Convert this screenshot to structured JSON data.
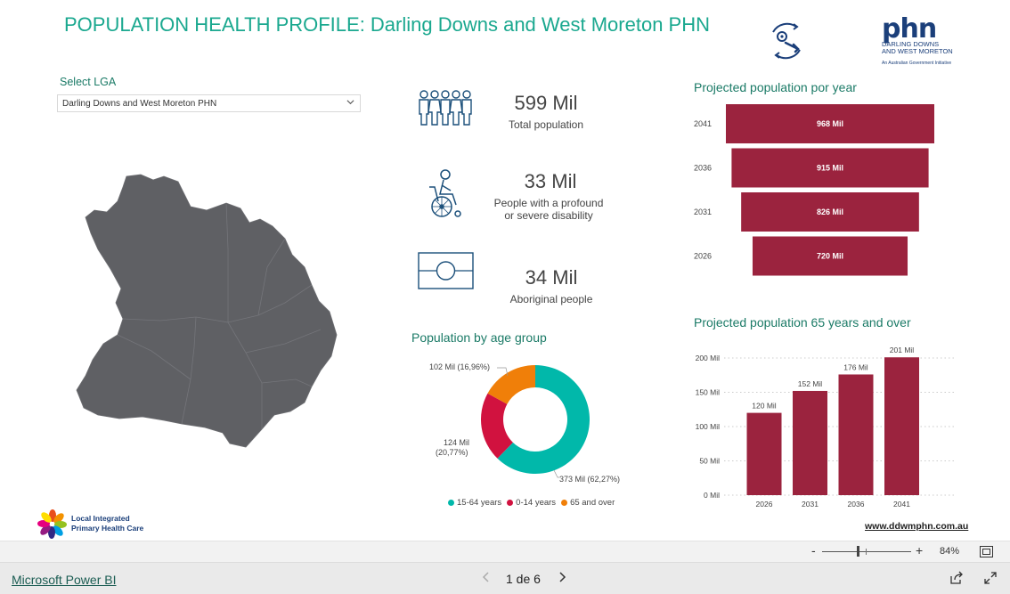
{
  "title": "POPULATION HEALTH PROFILE: Darling Downs and West Moreton PHN",
  "logos": {
    "phn_big": "phn",
    "phn_line1": "DARLING DOWNS",
    "phn_line2": "AND WEST MORETON",
    "phn_tagline": "An Australian Government Initiative",
    "lipc_line1": "Local Integrated",
    "lipc_line2": "Primary Health Care"
  },
  "filter": {
    "label": "Select LGA",
    "value": "Darling Downs and West Moreton PHN"
  },
  "kpis": {
    "total": {
      "value": "599 Mil",
      "label": "Total population",
      "icon": "people-group-icon"
    },
    "disability": {
      "value": "33 Mil",
      "label_line1": "People with a profound",
      "label_line2": "or severe disability",
      "icon": "wheelchair-icon"
    },
    "aboriginal": {
      "value": "34 Mil",
      "label": "Aboriginal people",
      "icon": "aboriginal-flag-icon"
    }
  },
  "sections": {
    "age_group": "Population by age group",
    "projected": "Projected population por year",
    "projected65": "Projected population 65 years and over"
  },
  "chart_data": [
    {
      "type": "pie",
      "title": "Population by age group",
      "donut": true,
      "categories": [
        "15-64 years",
        "0-14 years",
        "65 and over"
      ],
      "values": [
        373,
        124,
        102
      ],
      "percent": [
        62.27,
        20.77,
        16.96
      ],
      "labels": [
        "373 Mil (62,27%)",
        "124 Mil (20,77%)",
        "102 Mil (16,96%)"
      ],
      "colors": [
        "#01b8aa",
        "#d1123f",
        "#f07f09"
      ],
      "legend": "bottom"
    },
    {
      "type": "bar",
      "title": "Projected population por year",
      "orientation": "funnel",
      "categories": [
        "2041",
        "2036",
        "2031",
        "2026"
      ],
      "values": [
        968,
        915,
        826,
        720
      ],
      "labels": [
        "968 Mil",
        "915 Mil",
        "826 Mil",
        "720 Mil"
      ],
      "color": "#9b233e"
    },
    {
      "type": "bar",
      "title": "Projected population 65 years and over",
      "categories": [
        "2026",
        "2031",
        "2036",
        "2041"
      ],
      "values": [
        120,
        152,
        176,
        201
      ],
      "labels": [
        "120 Mil",
        "152 Mil",
        "176 Mil",
        "201 Mil"
      ],
      "yticks": [
        "0 Mil",
        "50 Mil",
        "100 Mil",
        "150 Mil",
        "200 Mil"
      ],
      "ylim": [
        0,
        200
      ],
      "grid": true,
      "color": "#9b233e"
    }
  ],
  "website": "www.ddwmphn.com.au",
  "zoom": {
    "minus": "-",
    "plus": "+",
    "value": "84%"
  },
  "footer": {
    "app_link": "Microsoft Power BI",
    "pager": "1 de 6"
  },
  "colors": {
    "accent_teal": "#1aa88f",
    "bar": "#9b233e",
    "map": "#5f6064"
  }
}
